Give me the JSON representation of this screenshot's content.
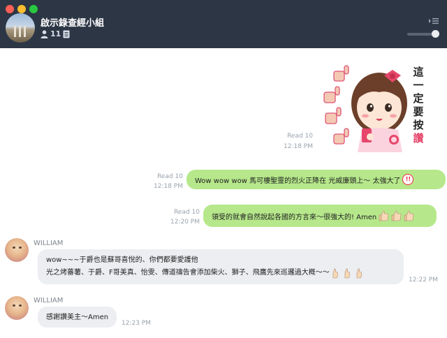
{
  "header": {
    "group_name": "啟示錄查經小組",
    "member_count": "11",
    "icons": [
      "person-icon",
      "note-icon",
      "menu-icon"
    ]
  },
  "messages": [
    {
      "type": "sticker",
      "side": "outgoing",
      "read": "Read 10",
      "time": "12:18 PM",
      "sticker_text": [
        "這",
        "一",
        "定",
        "要",
        "按",
        "讚"
      ]
    },
    {
      "type": "text",
      "side": "outgoing",
      "read": "Read 10",
      "time": "12:18 PM",
      "text": "Wow wow wow 馬可樓聖靈的烈火正降在 光威廉頭上～ 太強大了",
      "emoji": "!!"
    },
    {
      "type": "text",
      "side": "outgoing",
      "read": "Read 10",
      "time": "12:20 PM",
      "text": "領受的就會自然說起各國的方言來～很強大的! Amen"
    },
    {
      "type": "text",
      "side": "incoming",
      "sender": "WILLIAM",
      "time": "12:22 PM",
      "lines": [
        "wow~~~于爵也是蘇哥喜悅的、你們都要愛護他",
        "光之烤蕃薯、于爵、F哥美真、怡雯、傳道禱告會添加柴火、獅子、飛鷹先來巡邏過大概～～"
      ]
    },
    {
      "type": "text",
      "side": "incoming",
      "sender": "WILLIAM",
      "time": "12:23 PM",
      "text": "感謝讚美主～Amen"
    }
  ],
  "colors": {
    "header_bg": "#2c3645",
    "outgoing_bubble": "#b6e88b",
    "incoming_bubble": "#eceef1"
  }
}
